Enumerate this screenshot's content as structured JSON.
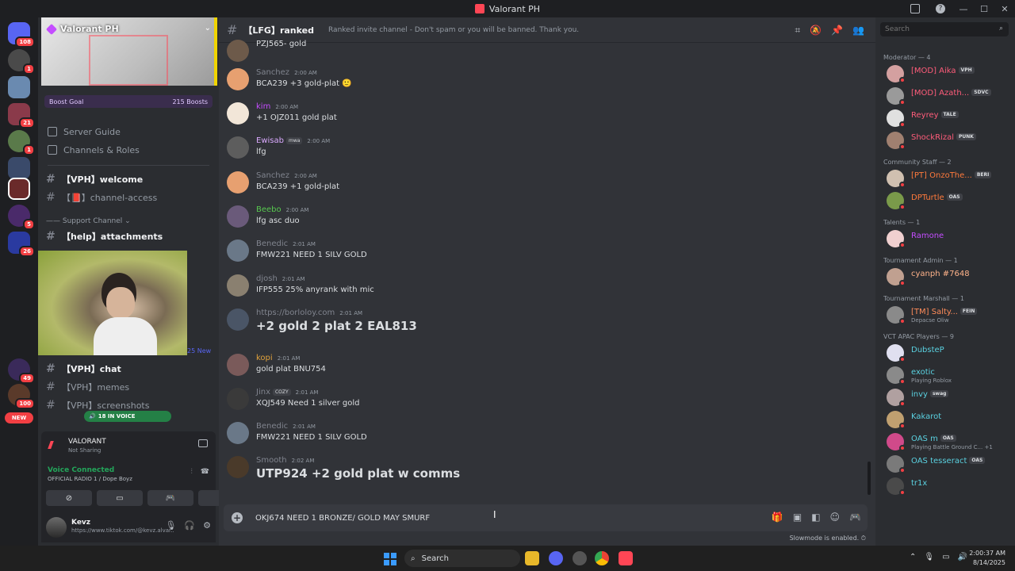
{
  "window": {
    "title": "Valorant PH",
    "controls": [
      "—",
      "☐",
      "✕"
    ]
  },
  "rail": {
    "badges": [
      "108",
      "1",
      "21",
      "1",
      "5",
      "26",
      "49",
      "100"
    ],
    "new_label": "NEW"
  },
  "server": {
    "name": "Valorant PH",
    "boost_goal": "Boost Goal",
    "boosts": "215 Boosts",
    "links": [
      "Server Guide",
      "Channels & Roles"
    ],
    "channels_top": [
      {
        "name": "【VPH】welcome",
        "bold": true
      },
      {
        "name": "【📕】channel-access",
        "bold": false
      }
    ],
    "support_category": "Support Channel",
    "channel_help": "【help】attachments",
    "webcam_new": "25 New",
    "channels_bottom": [
      {
        "name": "【VPH】chat",
        "bold": true
      },
      {
        "name": "【VPH】memes",
        "bold": false
      },
      {
        "name": "【VPH】screenshots",
        "bold": false
      }
    ],
    "voice_pill": "18 IN VOICE"
  },
  "activity": {
    "game": "VALORANT",
    "status": "Not Sharing"
  },
  "voice": {
    "status": "Voice Connected",
    "channel": "OFFICIAL RADIO 1 / Dope Boyz"
  },
  "user": {
    "name": "Kevz",
    "status": "https://www.tiktok.com/@kevz.alvar..."
  },
  "channel": {
    "name": "【LFG】ranked",
    "topic": "Ranked invite channel - Don't spam or you will be banned. Thank you."
  },
  "messages": [
    {
      "name": "",
      "time": "",
      "text": "PZJ565- gold",
      "color": "#dbdee1",
      "big": false,
      "avatar": "#6d5a4a"
    },
    {
      "name": "Sanchez",
      "time": "2:00 AM",
      "text": "BCA239 +3 gold-plat 🙂",
      "color": "#80848e",
      "big": false,
      "avatar": "#e7a070"
    },
    {
      "name": "kim",
      "time": "2:00 AM",
      "text": "+1 OJZ011 gold plat",
      "color": "#c44dff",
      "big": false,
      "avatar": "#f2e6d8"
    },
    {
      "name": "Ewisab",
      "tag": "mwa",
      "time": "2:00 AM",
      "text": "lfg",
      "color": "#dbaaff",
      "big": false,
      "avatar": "#5d5d5d"
    },
    {
      "name": "Sanchez",
      "time": "2:00 AM",
      "text": "BCA239 +1 gold-plat",
      "color": "#80848e",
      "big": false,
      "avatar": "#e7a070"
    },
    {
      "name": "Beebo",
      "time": "2:00 AM",
      "text": "lfg asc duo",
      "color": "#57c84f",
      "big": false,
      "avatar": "#6a5a7a"
    },
    {
      "name": "Benedic",
      "time": "2:01 AM",
      "text": "FMW221 NEED 1 SILV GOLD",
      "color": "#80848e",
      "big": false,
      "avatar": "#6a7888"
    },
    {
      "name": "djosh",
      "time": "2:01 AM",
      "text": "IFP555 25% anyrank with mic",
      "color": "#80848e",
      "big": false,
      "avatar": "#8a8070"
    },
    {
      "name": "https://borloloy.com",
      "time": "2:01 AM",
      "text": "+2 gold 2 plat 2 EAL813",
      "color": "#80848e",
      "big": true,
      "avatar": "#4a5566"
    },
    {
      "name": "kopi",
      "time": "2:01 AM",
      "text": "gold plat BNU754",
      "color": "#e0a23c",
      "big": false,
      "avatar": "#7a5a5a"
    },
    {
      "name": "Jinx",
      "tag": "COZY",
      "time": "2:01 AM",
      "text": "XQJ549 Need 1 silver gold",
      "color": "#80848e",
      "big": false,
      "avatar": "#3a3a3a"
    },
    {
      "name": "Benedic",
      "time": "2:01 AM",
      "text": "FMW221 NEED 1 SILV GOLD",
      "color": "#80848e",
      "big": false,
      "avatar": "#6a7888"
    },
    {
      "name": "Smooth",
      "time": "2:02 AM",
      "text": "UTP924 +2 gold plat w comms",
      "color": "#80848e",
      "big": true,
      "avatar": "#4a3a2a"
    }
  ],
  "composer": {
    "value": "OKJ674 NEED 1 BRONZE/ GOLD MAY SMURF",
    "slowmode": "Slowmode is enabled."
  },
  "search": {
    "placeholder": "Search"
  },
  "members": {
    "groups": [
      {
        "title": "Moderator — 4",
        "members": [
          {
            "name": "[MOD] Aika",
            "tag": "VPH",
            "color": "#ff5c7a",
            "sub": "",
            "avatar": "#d4a0a0"
          },
          {
            "name": "[MOD] Azath...",
            "tag": "SDVC",
            "color": "#ff5c7a",
            "sub": "",
            "avatar": "#9a9a9a"
          },
          {
            "name": "Reyrey",
            "tag": "TALE",
            "color": "#ff5c7a",
            "sub": "",
            "avatar": "#e0e0e0"
          },
          {
            "name": "ShockRizal",
            "tag": "PUNK",
            "color": "#ff5c7a",
            "sub": "",
            "avatar": "#a08070"
          }
        ]
      },
      {
        "title": "Community Staff — 2",
        "members": [
          {
            "name": "[PT] OnzoThe...",
            "tag": "BERI",
            "color": "#ff7a3c",
            "sub": "",
            "avatar": "#d0c0b0"
          },
          {
            "name": "DPTurtle",
            "tag": "OAS",
            "color": "#ff7a3c",
            "sub": "",
            "avatar": "#7a9a4a"
          }
        ]
      },
      {
        "title": "Talents — 1",
        "members": [
          {
            "name": "Ramone",
            "tag": "",
            "color": "#c44dff",
            "sub": "",
            "avatar": "#f0d0d0"
          }
        ]
      },
      {
        "title": "Tournament Admin — 1",
        "members": [
          {
            "name": "cyanph #7648",
            "tag": "",
            "color": "#ffb38a",
            "sub": "",
            "avatar": "#c0a090"
          }
        ]
      },
      {
        "title": "Tournament Marshall — 1",
        "members": [
          {
            "name": "[TM] Salty...",
            "tag": "FEIN",
            "color": "#ff8c5a",
            "sub": "Depacse Oliw",
            "avatar": "#8a8a8a"
          }
        ]
      },
      {
        "title": "VCT APAC Players — 9",
        "members": [
          {
            "name": "DubsteP",
            "tag": "",
            "color": "#5ad1e0",
            "sub": "",
            "avatar": "#e0e0f0"
          },
          {
            "name": "exotic",
            "tag": "",
            "color": "#5ad1e0",
            "sub": "Playing Roblox",
            "avatar": "#8a8a8a"
          },
          {
            "name": "invy",
            "tag": "swag",
            "color": "#5ad1e0",
            "sub": "",
            "avatar": "#b0a0a0"
          },
          {
            "name": "Kakarot",
            "tag": "",
            "color": "#5ad1e0",
            "sub": "",
            "avatar": "#c0a070"
          },
          {
            "name": "OAS m",
            "tag": "OAS",
            "color": "#5ad1e0",
            "sub": "Playing Battle Ground C... +1",
            "avatar": "#d04a8a"
          },
          {
            "name": "OAS tesseract",
            "tag": "OAS",
            "color": "#5ad1e0",
            "sub": "",
            "avatar": "#7a7a7a"
          },
          {
            "name": "tr1x",
            "tag": "",
            "color": "#5ad1e0",
            "sub": "",
            "avatar": "#4a4a4a"
          }
        ]
      }
    ]
  },
  "taskbar": {
    "search": "Search",
    "time": "2:00:37 AM",
    "date": "8/14/2025"
  },
  "colors": {
    "accent": "#5865f2",
    "online": "#23a55a",
    "dnd": "#f23f43"
  }
}
